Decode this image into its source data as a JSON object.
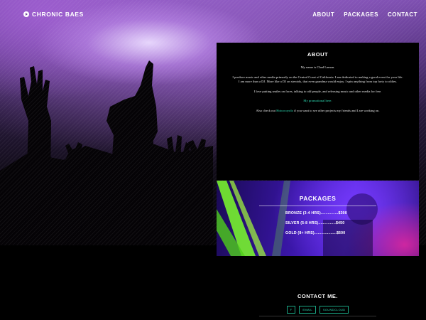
{
  "brand": {
    "name": "CHRONIC BAES",
    "icon": "play-circle-icon"
  },
  "nav": {
    "items": [
      "ABOUT",
      "PACKAGES",
      "CONTACT"
    ]
  },
  "about": {
    "title": "ABOUT",
    "p1": "My name is Chad Lamon.",
    "p2": "I produce music and other media primarily on the Central Coast of California. I am dedicated to making a good event for your life. I am more than a DJ. More like a DJ on steroids, that even grandma would enjoy. I spin anything from top forty to oldies.",
    "p3": "I love putting smiles on faces, talking to old people, and releasing music and other media for free.",
    "promo_link": "My promotional here.",
    "p5_prefix": "Also check out",
    "p5_link": "Hotcocoyolo",
    "p5_suffix": "if you want to see other projects my friends and I are working on."
  },
  "packages": {
    "title": "PACKAGES",
    "items": [
      "BRONZE (3-4 HRS)...............$300",
      "SILVER (5-8 HRS)...............$450",
      "GOLD (8+ HRS)...................$600"
    ]
  },
  "contact": {
    "title": "CONTACT ME.",
    "social": [
      "F",
      "EMAIL",
      "SOUNDCLOUD"
    ]
  },
  "colors": {
    "accent": "#2fe0b8",
    "hero_purple": "#7d4fb0",
    "packages_blue": "#3a16a8",
    "laser_green": "#7dff2a"
  }
}
